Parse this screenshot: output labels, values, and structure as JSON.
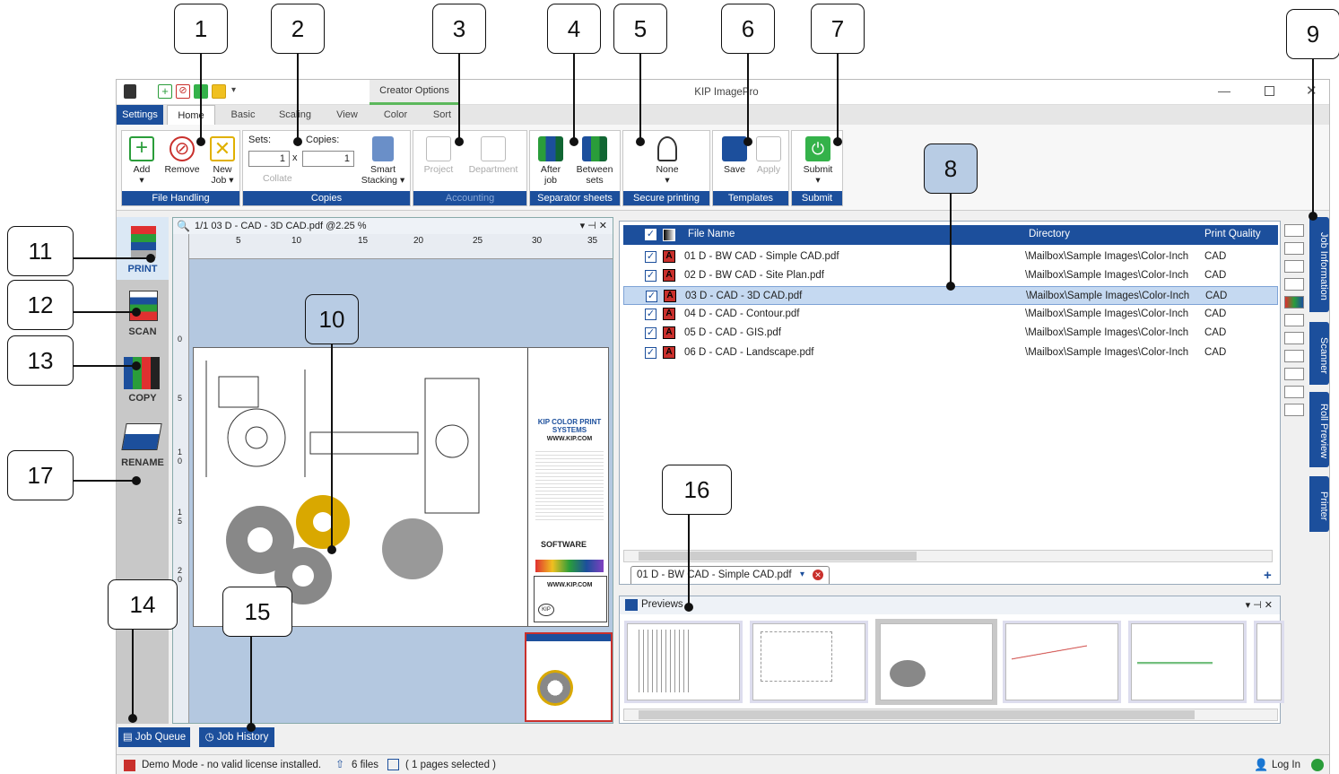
{
  "window": {
    "title": "KIP ImagePro",
    "context_tab": "Creator Options"
  },
  "tabs": [
    {
      "label": "Settings"
    },
    {
      "label": "Home"
    },
    {
      "label": "Basic"
    },
    {
      "label": "Scaling"
    },
    {
      "label": "View"
    },
    {
      "label": "Color"
    },
    {
      "label": "Sort"
    }
  ],
  "ribbon": {
    "file_handling": {
      "title": "File Handling",
      "add": "Add",
      "remove": "Remove",
      "new_job": "New Job"
    },
    "copies": {
      "title": "Copies",
      "sets_label": "Sets:",
      "copies_label": "Copies:",
      "sets_value": "1",
      "copies_value": "1",
      "times": "x",
      "collate": "Collate",
      "smart_stacking": "Smart Stacking"
    },
    "accounting": {
      "title": "Accounting",
      "project": "Project",
      "department": "Department"
    },
    "separator": {
      "title": "Separator sheets",
      "after_job": "After job",
      "between_sets": "Between sets"
    },
    "secure": {
      "title": "Secure printing",
      "none": "None"
    },
    "templates": {
      "title": "Templates",
      "save": "Save",
      "apply": "Apply"
    },
    "submit": {
      "title": "Submit",
      "submit": "Submit"
    }
  },
  "nav": {
    "print": "PRINT",
    "scan": "SCAN",
    "copy": "COPY",
    "rename": "RENAME"
  },
  "viewer": {
    "header": "1/1  03 D - CAD - 3D CAD.pdf  @2.25 %",
    "ruler_ticks": [
      "5",
      "10",
      "15",
      "20",
      "25",
      "30",
      "35"
    ],
    "vruler_ticks": [
      "0",
      "5",
      "1 0",
      "1 5",
      "2 0"
    ],
    "doc_brand": "KIP COLOR PRINT SYSTEMS",
    "doc_url": "WWW.KIP.COM",
    "doc_software": "SOFTWARE",
    "doc_footer_url": "WWW.KIP.COM",
    "doc_kip": "KIP"
  },
  "file_list": {
    "columns": {
      "name": "File Name",
      "directory": "Directory",
      "quality": "Print Quality"
    },
    "rows": [
      {
        "name": "01 D - BW CAD - Simple CAD.pdf",
        "directory": "\\Mailbox\\Sample Images\\Color-Inch",
        "quality": "CAD"
      },
      {
        "name": "02 D - BW CAD - Site Plan.pdf",
        "directory": "\\Mailbox\\Sample Images\\Color-Inch",
        "quality": "CAD"
      },
      {
        "name": "03 D - CAD - 3D CAD.pdf",
        "directory": "\\Mailbox\\Sample Images\\Color-Inch",
        "quality": "CAD"
      },
      {
        "name": "04 D - CAD - Contour.pdf",
        "directory": "\\Mailbox\\Sample Images\\Color-Inch",
        "quality": "CAD"
      },
      {
        "name": "05 D - CAD - GIS.pdf",
        "directory": "\\Mailbox\\Sample Images\\Color-Inch",
        "quality": "CAD"
      },
      {
        "name": "06 D - CAD - Landscape.pdf",
        "directory": "\\Mailbox\\Sample Images\\Color-Inch",
        "quality": "CAD"
      }
    ],
    "selected_index": 2,
    "doc_tab": "01 D - BW CAD - Simple CAD.pdf"
  },
  "previews": {
    "title": "Previews"
  },
  "side_tabs": [
    "Job Information",
    "Scanner",
    "Roll Preview",
    "Printer"
  ],
  "bottom_tabs": {
    "job_queue": "Job Queue",
    "job_history": "Job History"
  },
  "status": {
    "demo": "Demo Mode - no valid license installed.",
    "files": "6 files",
    "pages": "( 1 pages selected )",
    "login": "Log In"
  },
  "callouts": [
    "1",
    "2",
    "3",
    "4",
    "5",
    "6",
    "7",
    "8",
    "9",
    "10",
    "11",
    "12",
    "13",
    "14",
    "15",
    "16",
    "17"
  ],
  "colors": {
    "accent": "#1c4f9c",
    "selected_row": "#c5d9f1",
    "callout_fill": "#b8cce4"
  }
}
